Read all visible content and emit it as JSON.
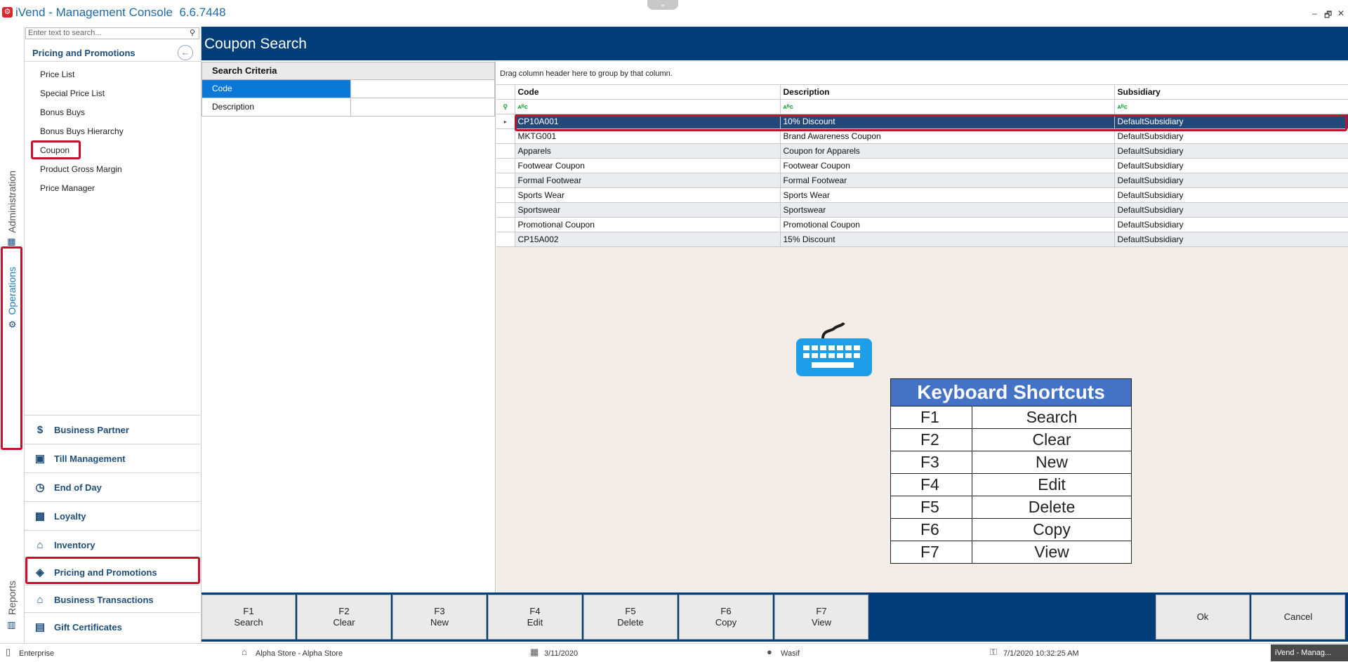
{
  "window": {
    "title": "iVend - Management Console",
    "version": "6.6.7448",
    "controls": [
      "–",
      "🗗",
      "✕"
    ]
  },
  "rail": {
    "administration": "Administration",
    "operations": "Operations",
    "reports": "Reports"
  },
  "nav": {
    "search_placeholder": "Enter text to search...",
    "header": "Pricing and Promotions",
    "items": [
      "Price List",
      "Special Price List",
      "Bonus Buys",
      "Bonus Buys Hierarchy",
      "Coupon",
      "Product Gross Margin",
      "Price Manager"
    ],
    "sections": [
      "Business Partner",
      "Till Management",
      "End of Day",
      "Loyalty",
      "Inventory",
      "Pricing and Promotions",
      "Business Transactions",
      "Gift Certificates"
    ]
  },
  "page": {
    "title": "Coupon Search"
  },
  "criteria": {
    "header": "Search Criteria",
    "fields": [
      {
        "label": "Code",
        "value": ""
      },
      {
        "label": "Description",
        "value": ""
      }
    ]
  },
  "grid": {
    "group_hint": "Drag column header here to group by that column.",
    "columns": [
      "Code",
      "Description",
      "Subsidiary"
    ],
    "filter_glyph": "ᴀᴮc",
    "rows": [
      {
        "code": "CP10A001",
        "description": "10% Discount",
        "subsidiary": "DefaultSubsidiary"
      },
      {
        "code": "MKTG001",
        "description": "Brand Awareness Coupon",
        "subsidiary": "DefaultSubsidiary"
      },
      {
        "code": "Apparels",
        "description": "Coupon for Apparels",
        "subsidiary": "DefaultSubsidiary"
      },
      {
        "code": "Footwear Coupon",
        "description": "Footwear Coupon",
        "subsidiary": "DefaultSubsidiary"
      },
      {
        "code": "Formal Footwear",
        "description": "Formal Footwear",
        "subsidiary": "DefaultSubsidiary"
      },
      {
        "code": "Sports Wear",
        "description": "Sports Wear",
        "subsidiary": "DefaultSubsidiary"
      },
      {
        "code": "Sportswear",
        "description": "Sportswear",
        "subsidiary": "DefaultSubsidiary"
      },
      {
        "code": "Promotional Coupon",
        "description": "Promotional Coupon",
        "subsidiary": "DefaultSubsidiary"
      },
      {
        "code": "CP15A002",
        "description": "15% Discount",
        "subsidiary": "DefaultSubsidiary"
      }
    ]
  },
  "shortcuts": {
    "title": "Keyboard Shortcuts",
    "rows": [
      {
        "key": "F1",
        "action": "Search"
      },
      {
        "key": "F2",
        "action": "Clear"
      },
      {
        "key": "F3",
        "action": "New"
      },
      {
        "key": "F4",
        "action": "Edit"
      },
      {
        "key": "F5",
        "action": "Delete"
      },
      {
        "key": "F6",
        "action": "Copy"
      },
      {
        "key": "F7",
        "action": "View"
      }
    ]
  },
  "fkeys": [
    {
      "key": "F1",
      "label": "Search"
    },
    {
      "key": "F2",
      "label": "Clear"
    },
    {
      "key": "F3",
      "label": "New"
    },
    {
      "key": "F4",
      "label": "Edit"
    },
    {
      "key": "F5",
      "label": "Delete"
    },
    {
      "key": "F6",
      "label": "Copy"
    },
    {
      "key": "F7",
      "label": "View"
    }
  ],
  "actions": {
    "ok": "Ok",
    "cancel": "Cancel"
  },
  "status": {
    "mode": "Enterprise",
    "store": "Alpha Store - Alpha Store",
    "date": "3/11/2020",
    "user": "Wasif",
    "datetime": "7/1/2020 10:32:25 AM",
    "taskbar": "iVend - Manag..."
  },
  "colors": {
    "brand": "#003d79",
    "highlight": "#c8102e",
    "selected_row": "#22497a",
    "shortcut_header": "#4472c4"
  }
}
